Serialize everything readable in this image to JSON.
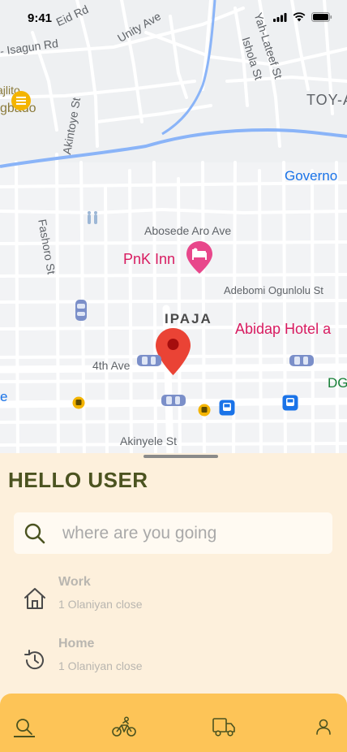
{
  "status_bar": {
    "time": "9:41"
  },
  "map": {
    "labels": {
      "eid_rd": "Eid Rd",
      "unity_ave": "Unity Ave",
      "yah_lateef": "Yah-Lateef St",
      "ishola": "Ishola St",
      "isagun": "- Isagun Rd",
      "akintoye": "Akintoye St",
      "toy": "TOY-A",
      "gbado_top": "ajlito",
      "gbado": "gbado",
      "governo": "Governo",
      "fashoro": "Fashoro St",
      "abosede": "Abosede Aro Ave",
      "pnk_inn": "PnK Inn",
      "adebomi": "Adebomi Ogunlolu St",
      "ipaja": "IPAJA",
      "abidap": "Abidap Hotel a",
      "fourth_ave": "4th Ave",
      "dg": "DG",
      "e": "e",
      "akinyele": "Akinyele St"
    },
    "colors": {
      "river": "#8ab4f8",
      "pin": "#ea4335",
      "poi": "#d81b60",
      "road": "#ffffff"
    }
  },
  "sheet": {
    "greeting": "HELLO USER",
    "search": {
      "placeholder": "where are you going",
      "value": ""
    },
    "places": [
      {
        "icon": "home-icon",
        "name": "Work",
        "address": "1 Olaniyan close"
      },
      {
        "icon": "history-icon",
        "name": "Home",
        "address": "1 Olaniyan close"
      }
    ]
  },
  "bottom_nav": {
    "items": [
      {
        "icon": "search-icon",
        "active": true
      },
      {
        "icon": "bike-icon",
        "active": false
      },
      {
        "icon": "truck-icon",
        "active": false
      },
      {
        "icon": "profile-icon",
        "active": false
      }
    ],
    "colors": {
      "background": "#fdc457",
      "icon": "#4b5320"
    }
  }
}
